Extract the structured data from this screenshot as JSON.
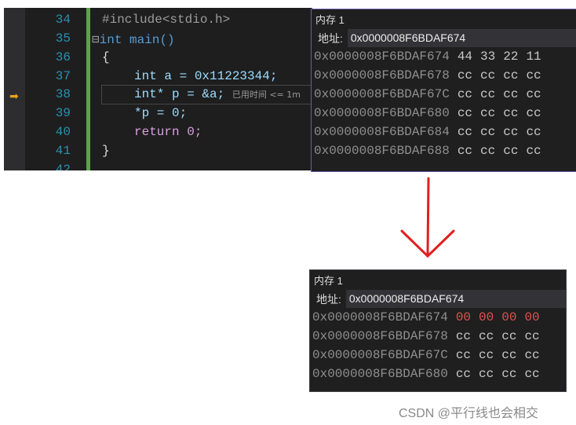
{
  "editor": {
    "lines": [
      {
        "n": "34",
        "code": "#include<stdio.h>"
      },
      {
        "n": "35",
        "code": "int main()"
      },
      {
        "n": "36",
        "code": "{"
      },
      {
        "n": "37",
        "code": "int a = 0x11223344;"
      },
      {
        "n": "38",
        "code": "int* p = &a;"
      },
      {
        "n": "39",
        "code": "*p = 0;"
      },
      {
        "n": "40",
        "code": "return 0;"
      },
      {
        "n": "41",
        "code": "}"
      },
      {
        "n": "42",
        "code": ""
      }
    ],
    "hint": "已用时间 <= 1m",
    "current_line": "38"
  },
  "memory_before": {
    "title": "内存 1",
    "address_label": "地址:",
    "address": "0x0000008F6BDAF674",
    "rows": [
      {
        "addr": "0x0000008F6BDAF674",
        "bytes": [
          "44",
          "33",
          "22",
          "11"
        ]
      },
      {
        "addr": "0x0000008F6BDAF678",
        "bytes": [
          "cc",
          "cc",
          "cc",
          "cc"
        ]
      },
      {
        "addr": "0x0000008F6BDAF67C",
        "bytes": [
          "cc",
          "cc",
          "cc",
          "cc"
        ]
      },
      {
        "addr": "0x0000008F6BDAF680",
        "bytes": [
          "cc",
          "cc",
          "cc",
          "cc"
        ]
      },
      {
        "addr": "0x0000008F6BDAF684",
        "bytes": [
          "cc",
          "cc",
          "cc",
          "cc"
        ]
      },
      {
        "addr": "0x0000008F6BDAF688",
        "bytes": [
          "cc",
          "cc",
          "cc",
          "cc"
        ]
      }
    ]
  },
  "memory_after": {
    "title": "内存 1",
    "address_label": "地址:",
    "address": "0x0000008F6BDAF674",
    "rows": [
      {
        "addr": "0x0000008F6BDAF674",
        "bytes": [
          "00",
          "00",
          "00",
          "00"
        ],
        "changed": true
      },
      {
        "addr": "0x0000008F6BDAF678",
        "bytes": [
          "cc",
          "cc",
          "cc",
          "cc"
        ]
      },
      {
        "addr": "0x0000008F6BDAF67C",
        "bytes": [
          "cc",
          "cc",
          "cc",
          "cc"
        ]
      },
      {
        "addr": "0x0000008F6BDAF680",
        "bytes": [
          "cc",
          "cc",
          "cc",
          "cc"
        ]
      }
    ]
  },
  "colors": {
    "arrow": "#e02020",
    "changed_bytes": "#e05252"
  },
  "watermark": "CSDN @平行线也会相交"
}
